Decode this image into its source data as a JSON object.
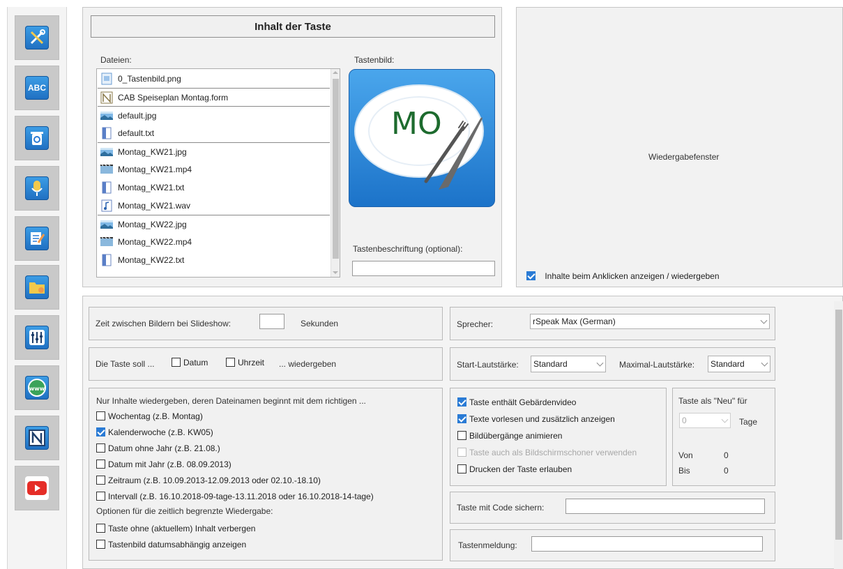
{
  "sidebar": {
    "buttons": [
      {
        "name": "tools-icon"
      },
      {
        "name": "spellcheck-abc-icon",
        "text": "ABC"
      },
      {
        "name": "trash-icon"
      },
      {
        "name": "microphone-icon"
      },
      {
        "name": "notepad-edit-icon"
      },
      {
        "name": "folder-pointer-icon"
      },
      {
        "name": "mixer-sliders-icon"
      },
      {
        "name": "www-globe-icon",
        "text": "www"
      },
      {
        "name": "form-n-icon",
        "text": "N"
      },
      {
        "name": "youtube-play-icon"
      }
    ]
  },
  "content_panel": {
    "title": "Inhalt der Taste",
    "files_label": "Dateien:",
    "image_label": "Tastenbild:",
    "files": [
      {
        "name": "0_Tastenbild.png",
        "icon": "image-file-icon"
      },
      {
        "name": "CAB Speiseplan Montag.form",
        "icon": "form-file-icon"
      },
      {
        "name": "default.jpg",
        "icon": "photo-file-icon"
      },
      {
        "name": "default.txt",
        "icon": "text-file-icon"
      },
      {
        "name": "Montag_KW21.jpg",
        "icon": "photo-file-icon"
      },
      {
        "name": "Montag_KW21.mp4",
        "icon": "video-file-icon"
      },
      {
        "name": "Montag_KW21.txt",
        "icon": "text-file-icon"
      },
      {
        "name": "Montag_KW21.wav",
        "icon": "audio-file-icon"
      },
      {
        "name": "Montag_KW22.jpg",
        "icon": "photo-file-icon"
      },
      {
        "name": "Montag_KW22.mp4",
        "icon": "video-file-icon"
      },
      {
        "name": "Montag_KW22.txt",
        "icon": "text-file-icon"
      }
    ],
    "button_image_text": "MO",
    "caption_label": "Tastenbeschriftung (optional):",
    "caption_value": ""
  },
  "playback_panel": {
    "title": "Wiedergabefenster",
    "show_on_click_label": "Inhalte beim Anklicken anzeigen / wiedergeben",
    "show_on_click_checked": true
  },
  "slideshow": {
    "label": "Zeit zwischen Bildern bei Slideshow:",
    "value": "",
    "unit": "Sekunden"
  },
  "show_datetime": {
    "prefix": "Die Taste soll ...",
    "date_label": "Datum",
    "time_label": "Uhrzeit",
    "suffix": "... wiedergeben"
  },
  "filename_filter": {
    "heading": "Nur Inhalte wiedergeben, deren Dateinamen beginnt mit dem richtigen ...",
    "options": [
      {
        "label": "Wochentag (z.B. Montag)",
        "checked": false
      },
      {
        "label": "Kalenderwoche (z.B. KW05)",
        "checked": true
      },
      {
        "label": "Datum ohne Jahr (z.B. 21.08.)",
        "checked": false
      },
      {
        "label": "Datum mit Jahr (z.B. 08.09.2013)",
        "checked": false
      },
      {
        "label": "Zeitraum (z.B. 10.09.2013-12.09.2013 oder 02.10.-18.10)",
        "checked": false
      },
      {
        "label": "Intervall (z.B. 16.10.2018-09-tage-13.11.2018 oder 16.10.2018-14-tage)",
        "checked": false
      }
    ],
    "time_options_heading": "Optionen für die zeitlich begrenzte Wiedergabe:",
    "time_options": [
      {
        "label": "Taste ohne (aktuellem) Inhalt verbergen",
        "checked": false
      },
      {
        "label": "Tastenbild datumsabhängig anzeigen",
        "checked": false
      }
    ]
  },
  "speaker": {
    "label": "Sprecher:",
    "value": "rSpeak Max (German)"
  },
  "volume": {
    "start_label": "Start-Lautstärke:",
    "start_value": "Standard",
    "max_label": "Maximal-Lautstärke:",
    "max_value": "Standard"
  },
  "options": [
    {
      "label": "Taste enthält Gebärdenvideo",
      "checked": true,
      "disabled": false
    },
    {
      "label": "Texte vorlesen und zusätzlich anzeigen",
      "checked": true,
      "disabled": false
    },
    {
      "label": "Bildübergänge animieren",
      "checked": false,
      "disabled": false
    },
    {
      "label": "Taste auch als Bildschirmschoner verwenden",
      "checked": false,
      "disabled": true
    },
    {
      "label": "Drucken der Taste erlauben",
      "checked": false,
      "disabled": false
    }
  ],
  "new_flag": {
    "label": "Taste als \"Neu\" für",
    "value": "0",
    "unit": "Tage",
    "from_label": "Von",
    "from_value": "0",
    "to_label": "Bis",
    "to_value": "0"
  },
  "code_lock": {
    "label": "Taste mit Code sichern:",
    "value": ""
  },
  "message": {
    "label": "Tastenmeldung:",
    "value": ""
  }
}
